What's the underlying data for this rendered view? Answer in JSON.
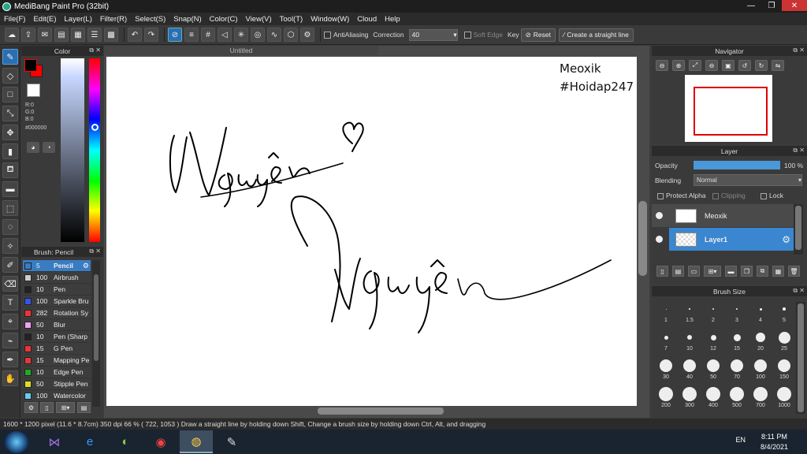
{
  "window": {
    "title": "MediBang Paint Pro (32bit)",
    "controls": [
      "—",
      "❐",
      "✕"
    ]
  },
  "menu": [
    "File(F)",
    "Edit(E)",
    "Layer(L)",
    "Filter(R)",
    "Select(S)",
    "Snap(N)",
    "Color(C)",
    "View(V)",
    "Tool(T)",
    "Window(W)",
    "Cloud",
    "Help"
  ],
  "toolbar": {
    "antialiasing_label": "AntiAliasing",
    "correction_label": "Correction",
    "correction_value": "40",
    "soft_edge_label": "Soft Edge",
    "key_label": "Key",
    "reset_label": "Reset",
    "straight_line_label": "Create a straight line"
  },
  "color_panel": {
    "title": "Color",
    "r": "R:0",
    "g": "G:0",
    "b": "B:0",
    "hex": "#000000",
    "foreground": "#000000",
    "background_swatch": "#ff0000"
  },
  "brush_panel": {
    "title": "Brush: Pencil",
    "items": [
      {
        "size": "5",
        "name": "Pencil",
        "color": "#3a7cc2",
        "selected": true
      },
      {
        "size": "100",
        "name": "Airbrush",
        "color": "#cccccc"
      },
      {
        "size": "10",
        "name": "Pen",
        "color": "#222222"
      },
      {
        "size": "100",
        "name": "Sparkle Bru",
        "color": "#3355ee"
      },
      {
        "size": "282",
        "name": "Rotation Sy",
        "color": "#ee3333"
      },
      {
        "size": "50",
        "name": "Blur",
        "color": "#f0a0f0"
      },
      {
        "size": "10",
        "name": "Pen (Sharp",
        "color": "#222222"
      },
      {
        "size": "15",
        "name": "G Pen",
        "color": "#ee3333"
      },
      {
        "size": "15",
        "name": "Mapping Pe",
        "color": "#ee3333"
      },
      {
        "size": "10",
        "name": "Edge Pen",
        "color": "#22aa22"
      },
      {
        "size": "50",
        "name": "Stipple Pen",
        "color": "#dddd22"
      },
      {
        "size": "100",
        "name": "Watercolor",
        "color": "#66ccee"
      }
    ]
  },
  "canvas": {
    "tab": "Untitled",
    "text_line1": "Meoxik",
    "text_line2": "#Hoidap247"
  },
  "navigator": {
    "title": "Navigator"
  },
  "layer_panel": {
    "title": "Layer",
    "opacity_label": "Opacity",
    "opacity_value": "100 %",
    "opacity_fraction": 1.0,
    "blending_label": "Blending",
    "blending_value": "Normal",
    "protect_alpha": "Protect Alpha",
    "clipping": "Clipping",
    "lock": "Lock",
    "layers": [
      {
        "name": "Meoxik",
        "selected": false
      },
      {
        "name": "Layer1",
        "selected": true
      }
    ]
  },
  "brush_size": {
    "title": "Brush Size",
    "sizes": [
      "1",
      "1.5",
      "2",
      "3",
      "4",
      "5",
      "7",
      "10",
      "12",
      "15",
      "20",
      "25",
      "30",
      "40",
      "50",
      "70",
      "100",
      "150",
      "200",
      "300",
      "400",
      "500",
      "700",
      "1000"
    ]
  },
  "status": "1600 * 1200 pixel  (11.6 * 8.7cm)  350 dpi  66 %  ( 722, 1053 )  Draw a straight line by holding down Shift, Change a brush size by holding down Ctrl, Alt, and dragging",
  "taskbar": {
    "lang": "EN",
    "time": "8:11 PM",
    "date": "8/4/2021"
  }
}
